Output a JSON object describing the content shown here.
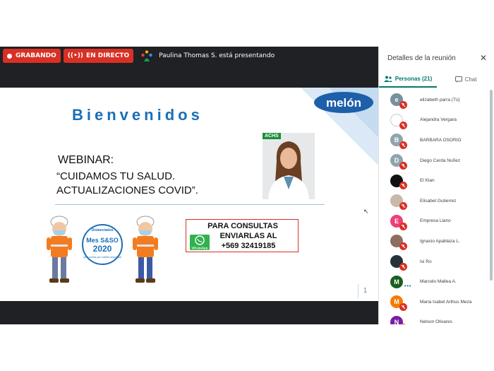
{
  "top_bar": {
    "recording_label": "GRABANDO",
    "live_label": "EN DIRECTO",
    "presenter_text": "Paulina Thomas S. está presentando"
  },
  "slide": {
    "welcome": "Bienvenidos",
    "webinar_label": "WEBINAR:",
    "subtitle_line1": "“CUIDAMOS TU SALUD.",
    "subtitle_line2": "ACTUALIZACIONES COVID”.",
    "brand": "melón",
    "achs_badge": "ACHS",
    "contact_line1": "PARA CONSULTAS",
    "contact_line2": "ENVIARLAS AL",
    "contact_phone": "+569 32419185",
    "whatsapp_label": "WhatsApp",
    "badge_top": "Distanciados",
    "badge_title": "Mes S&SO",
    "badge_year": "2020",
    "badge_bottom": "pero unidos por nuestra seguridad",
    "page_number": "1"
  },
  "panel": {
    "title": "Detalles de la reunión",
    "tab_people": "Personas (21)",
    "tab_chat": "Chat",
    "participants": [
      {
        "name": "elizabeth parra (Tú)",
        "initial": "e",
        "color": "#78909c"
      },
      {
        "name": "Alejandra Vergara",
        "initial": "",
        "color": "#ffffff"
      },
      {
        "name": "BARBARA OSORIO",
        "initial": "B",
        "color": "#90a4ae"
      },
      {
        "name": "Diego Cerda Nuñez",
        "initial": "D",
        "color": "#90a4ae"
      },
      {
        "name": "El Klan",
        "initial": "",
        "color": "#111111"
      },
      {
        "name": "Elisabet Gutierrez",
        "initial": "",
        "color": "#c8b9a8"
      },
      {
        "name": "Empresa Llano",
        "initial": "E",
        "color": "#ec407a"
      },
      {
        "name": "Ignacio Apablaza L.",
        "initial": "",
        "color": "#8d6e63"
      },
      {
        "name": "Isi Ro",
        "initial": "",
        "color": "#263238"
      },
      {
        "name": "Marcelo Mallea A.",
        "initial": "M",
        "color": "#1b5e20"
      },
      {
        "name": "Maria Isabel Arthus Meza",
        "initial": "M",
        "color": "#f57c00"
      },
      {
        "name": "Nelson Olivares",
        "initial": "N",
        "color": "#7b1fa2"
      }
    ]
  }
}
